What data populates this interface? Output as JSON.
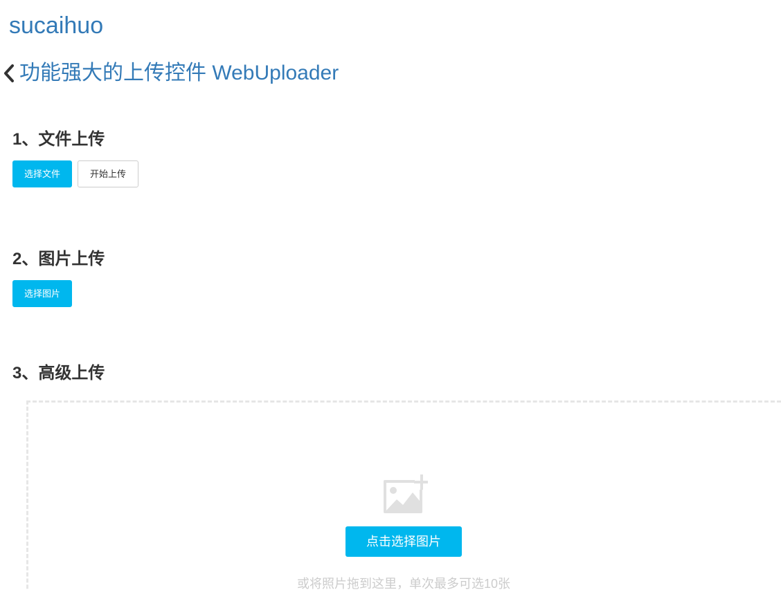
{
  "header": {
    "brand": "sucaihuo",
    "page_title": "功能强大的上传控件 WebUploader"
  },
  "sections": [
    {
      "title": "1、文件上传",
      "buttons": {
        "pick": "选择文件",
        "start": "开始上传"
      }
    },
    {
      "title": "2、图片上传",
      "buttons": {
        "pick": "选择图片"
      }
    },
    {
      "title": "3、高级上传",
      "dropzone": {
        "icon": "add-image-icon",
        "button": "点击选择图片",
        "hint": "或将照片拖到这里，单次最多可选10张"
      }
    }
  ],
  "colors": {
    "link": "#337ab7",
    "primary": "#00b7ee",
    "text": "#333333",
    "muted": "#cccccc",
    "dashed_border": "#e6e6e6"
  }
}
